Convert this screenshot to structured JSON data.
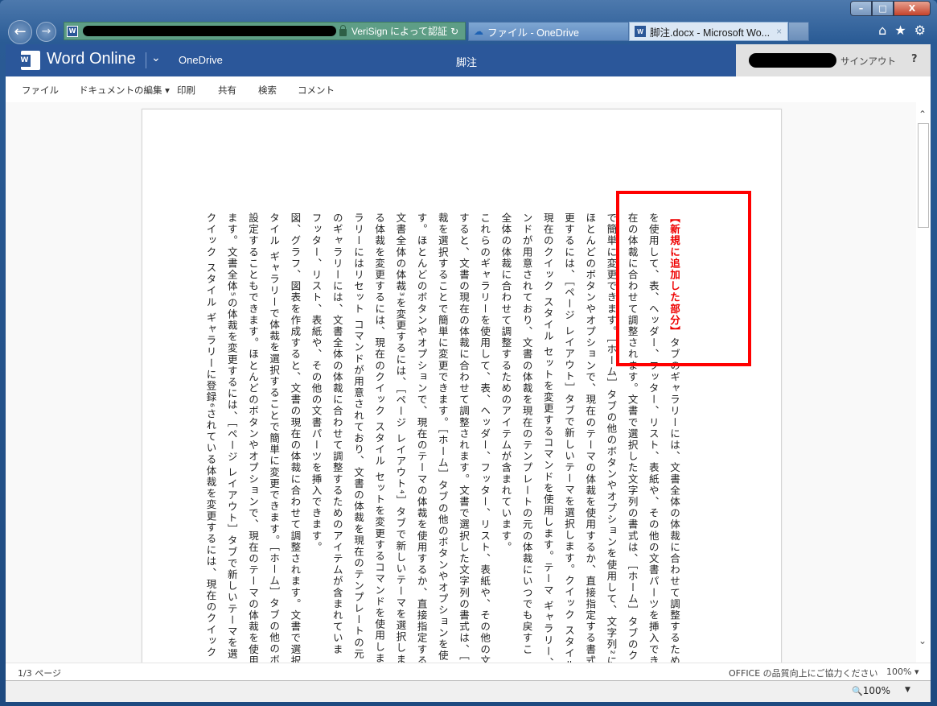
{
  "browser": {
    "address_bar": {
      "certificate_label": "VeriSign によって認証"
    },
    "tabs": [
      {
        "label": "ファイル - OneDrive",
        "icon": "onedrive-cloud-icon",
        "active": false
      },
      {
        "label": "脚注.docx - Microsoft Wo...",
        "icon": "word-icon",
        "active": true
      }
    ],
    "window_controls": {
      "minimize": "–",
      "maximize": "□",
      "close": "X"
    },
    "toolbar_icons": [
      "home-icon",
      "favorites-star-icon",
      "settings-gear-icon"
    ],
    "glyphs": {
      "back": "←",
      "forward": "→",
      "refresh": "↻",
      "home": "⌂",
      "star": "★",
      "gear": "⚙",
      "tab_close": "×",
      "cloud": "☁"
    }
  },
  "app": {
    "logo_text": "W",
    "name": "Word Online",
    "chevron": "⌄",
    "onedrive_link": "OneDrive",
    "document_title": "脚注",
    "signout": "サインアウト",
    "help": "?"
  },
  "ribbon": {
    "items": [
      {
        "label": "ファイル"
      },
      {
        "label": "ドキュメントの編集 ▾"
      },
      {
        "label": "印刷"
      },
      {
        "label": "共有"
      },
      {
        "label": "検索"
      },
      {
        "label": "コメント"
      }
    ]
  },
  "document": {
    "highlight_label": "【新規に追加した部分】",
    "highlight_color": "#ff0000",
    "columns": [
      "【新規に追加した部分】タブのギャラリーには、文書全体の体裁に合わせて調整するため",
      "を使用して、表、ヘッダー、フッター、リスト、表紙や、その他の文書パーツを挿入でき",
      "在の体裁に合わせて調整されます。文書で選択した文字列の書式は、［ホーム］タブのク",
      "で簡単に変更できます。［ホーム］タブの他のボタンやオプションを使用して、文字列²に",
      "ほとんどのボタンやオプションで、現在のテーマの体裁を使用するか、直接指定する書式",
      "更するには、［ページ レイアウト］タブで新しいテーマを選択します。クイック スタイル",
      "現在のクイック スタイル セットを変更するコマンドを使用します。テーマ ギャラリー、",
      "ンドが用意されており、文書の体裁を現在のテンプレートの元の体裁にいつでも戻すこ",
      "全体の体裁に合わせて調整するためのアイテムが含まれています。",
      "これらのギャラリーを使用して、表、ヘッダー、フッター、リスト、表紙や、その他の文",
      "すると、文書の現在の体裁に合わせて調整されます。文書で選択した文字列の書式は、［",
      "裁を選択することで簡単に変更できます。［ホーム］タブの他のボタンやオプションを使",
      "す。ほとんどのボタンやオプションで、現在のテーマの体裁を使用するか、直接指定する",
      "文書全体の体裁³を変更するには、［ページ レイアウト⁴］タブで新しいテーマを選択しま",
      "る体裁を変更するには、現在のクイック スタイル セットを変更するコマンドを使用しま",
      "ラリーにはリセット コマンドが用意されており、文書の体裁を現在のテンプレートの元",
      "のギャラリーには、文書全体の体裁に合わせて調整するためのアイテムが含まれていま",
      "フッター、リスト、表紙や、その他の文書パーツを挿入できます。",
      "図、グラフ、図表を作成すると、文書の現在の体裁に合わせて調整されます。文書で選択",
      "タイル ギャラリーで体裁を選択することで簡単に変更できます。［ホーム］タブの他のボ",
      "設定することもできます。ほとんどのボタンやオプションで、現在のテーマの体裁を使用",
      "ます。文書全体⁵の体裁を変更するには、［ページ レイアウト］タブで新しいテーマを選",
      "クイック スタイル ギャラリーに登録⁶されている体裁を変更するには、現在のクイック"
    ]
  },
  "scrollbar": {
    "up": "⌃",
    "down": "⌄"
  },
  "status": {
    "page_count": "1/3 ページ",
    "feedback": "OFFICE の品質向上にご協力ください",
    "zoom": "100% ▾"
  },
  "ie_status": {
    "zoom": "100%",
    "zoom_caret": "▼",
    "zoom_icon": "🔍"
  }
}
